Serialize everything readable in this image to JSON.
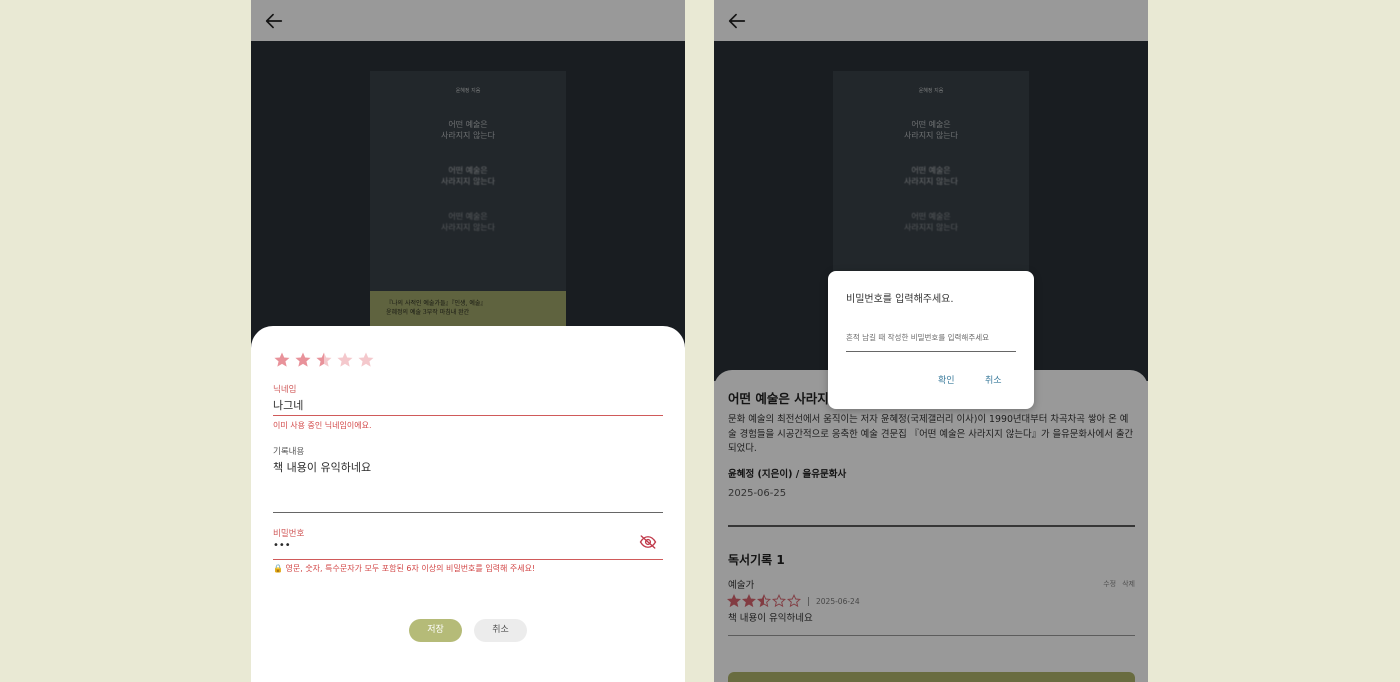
{
  "left_screen": {
    "cover": {
      "author": "윤혜정 지음",
      "title_lines": [
        "어떤 예술은",
        "사라지지 않는다"
      ],
      "band_text_1": "『나의 사적인 예술가들』『인생, 예술』",
      "band_text_2": "윤혜정의 예술 3부작 마침내 완간"
    },
    "form": {
      "rating": 2.5,
      "nickname_label": "닉네임",
      "nickname_value": "나그네",
      "nickname_error": "이미 사용 중인 닉네임이에요.",
      "content_label": "기록내용",
      "content_value": "책 내용이 유익하네요",
      "password_label": "비밀번호",
      "password_value": "•••",
      "password_hint": "영문, 숫자, 특수문자가 모두 포함된 6자 이상의 비밀번호를 입력해 주세요!",
      "save_label": "저장",
      "cancel_label": "취소"
    }
  },
  "right_screen": {
    "book": {
      "title": "어떤 예술은 사라지지 않는다",
      "description": "문화 예술의 최전선에서 움직이는 저자 윤혜정(국제갤러리 이사)이 1990년대부터 차곡차곡 쌓아 온 예술 경험들을 시공간적으로 응축한 예술 견문집 『어떤 예술은 사라지지 않는다』가 을유문화사에서 출간되었다.",
      "author_publisher": "윤혜정 (지은이) / 을유문화사",
      "date": "2025-06-25"
    },
    "records": {
      "title": "독서기록 1",
      "items": [
        {
          "author": "예술가",
          "rating": 2.5,
          "date": "2025-06-24",
          "text": "책 내용이 유익하네요",
          "edit_label": "수정",
          "delete_label": "삭제"
        }
      ]
    },
    "dialog": {
      "title": "비밀번호를 입력해주세요.",
      "placeholder": "흔적 남길 때 작성한 비밀번호를 입력해주세요",
      "confirm_label": "확인",
      "cancel_label": "취소"
    }
  },
  "colors": {
    "background": "#e9e9d4",
    "accent_olive": "#b5bb78",
    "error_red": "#d24646",
    "star_pink": "#e8929a",
    "link_blue": "#3b7b9c"
  },
  "icons": {
    "back": "arrow-left-icon",
    "visibility": "eye-off-icon",
    "lock": "lock-icon",
    "star": "star-icon"
  }
}
